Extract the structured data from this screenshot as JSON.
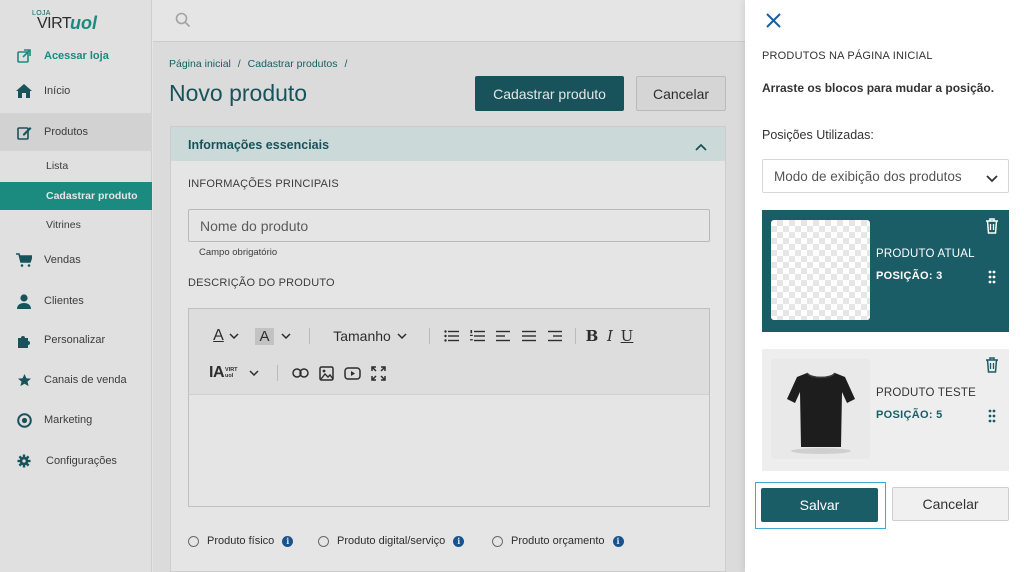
{
  "brand": {
    "loja": "LOJA",
    "virt": "VIRT",
    "uol": "uol"
  },
  "sidebar": {
    "items": [
      {
        "label": "Acessar loja",
        "icon": "external-link-icon"
      },
      {
        "label": "Início",
        "icon": "home-icon"
      },
      {
        "label": "Produtos",
        "icon": "edit-icon"
      },
      {
        "label": "Vendas",
        "icon": "cart-icon"
      },
      {
        "label": "Clientes",
        "icon": "user-icon"
      },
      {
        "label": "Personalizar",
        "icon": "puzzle-icon"
      },
      {
        "label": "Canais de venda",
        "icon": "star-icon"
      },
      {
        "label": "Marketing",
        "icon": "target-icon"
      },
      {
        "label": "Configurações",
        "icon": "gear-icon"
      }
    ],
    "subitems": [
      {
        "label": "Lista"
      },
      {
        "label": "Cadastrar produto"
      },
      {
        "label": "Vitrines"
      }
    ]
  },
  "breadcrumb": [
    "Página inicial",
    "/",
    "Cadastrar produtos",
    "/"
  ],
  "page": {
    "title": "Novo produto",
    "primary_button": "Cadastrar produto",
    "secondary_button": "Cancelar"
  },
  "card": {
    "header": "Informações essenciais",
    "section_main": "INFORMAÇÕES PRINCIPAIS",
    "name_placeholder": "Nome do produto",
    "name_value": "",
    "helper": "Campo obrigatório",
    "section_desc": "DESCRIÇÃO DO PRODUTO",
    "toolbar": {
      "size_label": "Tamanho",
      "font_color_glyph": "A",
      "bg_color_glyph": "A",
      "bold": "B",
      "italic": "I",
      "underline": "U",
      "ia_label": "IA",
      "ia_brand": "VIRT uol"
    },
    "product_types": [
      {
        "label": "Produto físico"
      },
      {
        "label": "Produto digital/serviço"
      },
      {
        "label": "Produto orçamento"
      }
    ]
  },
  "drawer": {
    "title": "PRODUTOS NA PÁGINA INICIAL",
    "instructions": "Arraste os blocos para mudar a posição.",
    "positions_label": "Posições Utilizadas:",
    "select_value": "Modo de exibição dos produtos",
    "blocks": [
      {
        "name": "PRODUTO ATUAL",
        "position": "POSIÇÃO: 3",
        "image": "transparent-placeholder"
      },
      {
        "name": "PRODUTO TESTE",
        "position": "POSIÇÃO: 5",
        "image": "black-tshirt"
      }
    ],
    "save": "Salvar",
    "cancel": "Cancelar"
  },
  "colors": {
    "primary": "#1b5d66",
    "accent": "#1f9a8e",
    "focus": "#3fa9d6"
  }
}
